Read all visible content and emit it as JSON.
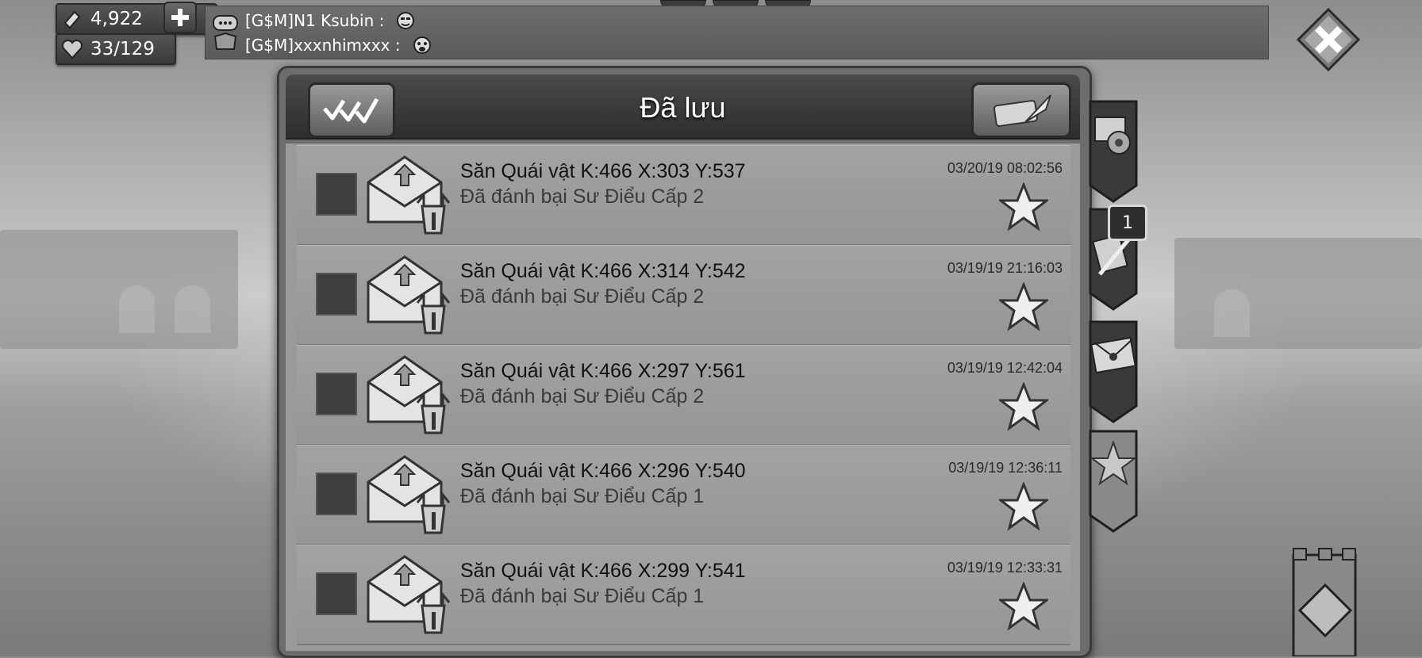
{
  "resources": {
    "gems": "4,922",
    "stamina": "33/129"
  },
  "chat": {
    "lines": [
      {
        "sender": "[G$M]N1 Ksubin :"
      },
      {
        "sender": "[G$M]xxxnhimxxx :"
      }
    ]
  },
  "panel": {
    "title": "Đã lưu"
  },
  "mails": [
    {
      "title": "Săn Quái vật K:466 X:303 Y:537",
      "subtitle": "Đã đánh bại Sư Điểu Cấp 2",
      "date": "03/20/19 08:02:56",
      "starred": true
    },
    {
      "title": "Săn Quái vật K:466 X:314 Y:542",
      "subtitle": "Đã đánh bại Sư Điểu Cấp 2",
      "date": "03/19/19 21:16:03",
      "starred": true
    },
    {
      "title": "Săn Quái vật K:466 X:297 Y:561",
      "subtitle": "Đã đánh bại Sư Điểu Cấp 2",
      "date": "03/19/19 12:42:04",
      "starred": true
    },
    {
      "title": "Săn Quái vật K:466 X:296 Y:540",
      "subtitle": "Đã đánh bại Sư Điểu Cấp 1",
      "date": "03/19/19 12:36:11",
      "starred": true
    },
    {
      "title": "Săn Quái vật K:466 X:299 Y:541",
      "subtitle": "Đã đánh bại Sư Điểu Cấp 1",
      "date": "03/19/19 12:33:31",
      "starred": true
    }
  ],
  "side_tabs": {
    "badge": "1",
    "icons": [
      "settings-mail-icon",
      "battle-report-icon",
      "sealed-letter-icon",
      "saved-star-icon"
    ]
  }
}
